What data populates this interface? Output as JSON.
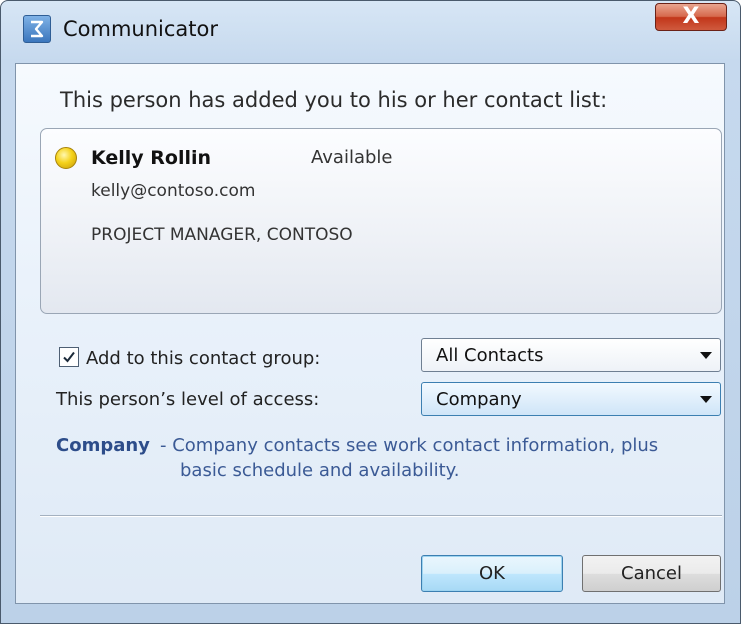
{
  "window": {
    "title": "Communicator",
    "close_label": "X"
  },
  "dialog": {
    "prompt": "This person has added you to his or her contact list:",
    "contact": {
      "name": "Kelly Rollin",
      "status": "Available",
      "email": "kelly@contoso.com",
      "title": "PROJECT MANAGER, CONTOSO",
      "presence_color": "#f5d21a"
    },
    "group": {
      "label": "Add to this contact group:",
      "checked": true,
      "selected": "All Contacts"
    },
    "access": {
      "label": "This person’s level of access:",
      "selected": "Company"
    },
    "description": {
      "name": "Company",
      "line1": "- Company contacts see work contact information, plus",
      "line2": "basic schedule and availability."
    },
    "buttons": {
      "ok": "OK",
      "cancel": "Cancel"
    }
  },
  "icons": [
    "communicator-app-icon",
    "presence-icon",
    "check-icon",
    "chevron-down-icon"
  ]
}
